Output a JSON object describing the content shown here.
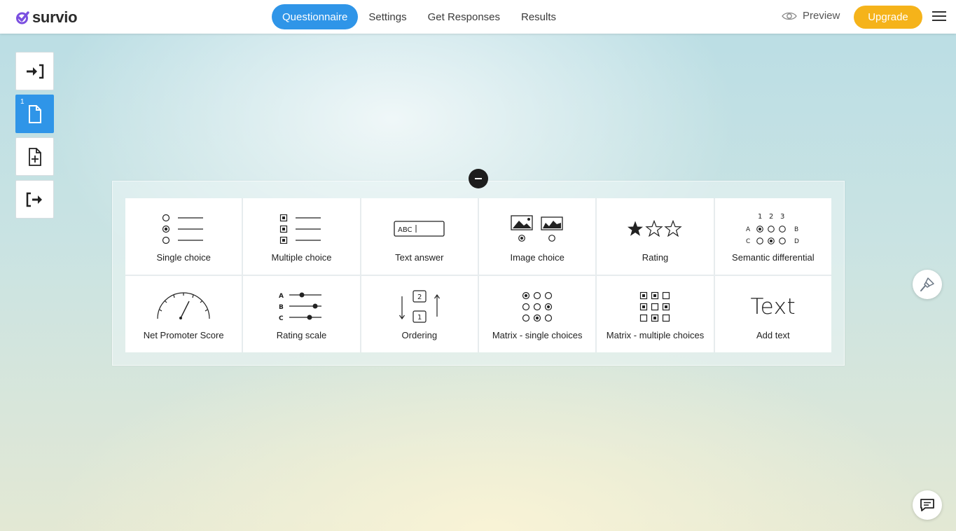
{
  "app": {
    "name": "survio",
    "brand_color": "#7b4fe0",
    "accent_color": "#2f95e8",
    "upgrade_color": "#f5b31a"
  },
  "nav": {
    "tabs": [
      {
        "label": "Questionnaire",
        "active": true
      },
      {
        "label": "Settings",
        "active": false
      },
      {
        "label": "Get Responses",
        "active": false
      },
      {
        "label": "Results",
        "active": false
      }
    ],
    "preview_label": "Preview",
    "upgrade_label": "Upgrade",
    "menu_icon": "hamburger-icon"
  },
  "pages": {
    "items": [
      {
        "icon": "intro-page-icon"
      },
      {
        "icon": "page-icon",
        "number": "1",
        "active": true
      },
      {
        "icon": "add-page-icon"
      },
      {
        "icon": "exit-page-icon"
      }
    ]
  },
  "question_types": [
    {
      "label": "Single choice",
      "icon": "single-choice-icon"
    },
    {
      "label": "Multiple choice",
      "icon": "multiple-choice-icon"
    },
    {
      "label": "Text answer",
      "icon": "text-answer-icon",
      "sample": "ABC"
    },
    {
      "label": "Image choice",
      "icon": "image-choice-icon"
    },
    {
      "label": "Rating",
      "icon": "rating-icon"
    },
    {
      "label": "Semantic differential",
      "icon": "semantic-differential-icon",
      "cols": [
        "1",
        "2",
        "3"
      ],
      "rows": [
        "A",
        "B",
        "C",
        "D"
      ]
    },
    {
      "label": "Net Promoter Score",
      "icon": "gauge-icon"
    },
    {
      "label": "Rating scale",
      "icon": "rating-scale-icon",
      "rows": [
        "A",
        "B",
        "C"
      ]
    },
    {
      "label": "Ordering",
      "icon": "ordering-icon",
      "items": [
        "2",
        "1"
      ]
    },
    {
      "label": "Matrix - single choices",
      "icon": "matrix-single-icon"
    },
    {
      "label": "Matrix - multiple choices",
      "icon": "matrix-multiple-icon"
    },
    {
      "label": "Add text",
      "icon": "text-icon",
      "sample": "Text"
    }
  ],
  "floating": {
    "design_icon": "paintbrush-icon",
    "chat_icon": "chat-icon"
  }
}
